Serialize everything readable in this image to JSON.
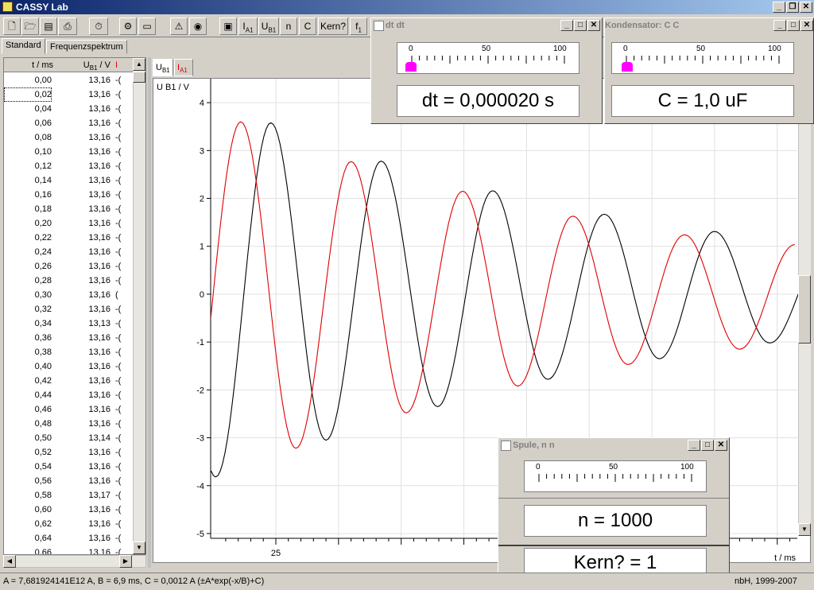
{
  "window": {
    "title": "CASSY Lab"
  },
  "toolbar": {
    "btn_n": "n",
    "btn_c": "C",
    "btn_kern": "Kern?",
    "btn_f1": "f"
  },
  "tabs": [
    "Standard",
    "Frequenzspektrum"
  ],
  "table": {
    "headers": [
      "t / ms",
      "U",
      "I"
    ],
    "header_unit": "/ V",
    "rows": [
      [
        "0,00",
        "13,16",
        "-("
      ],
      [
        "0,02",
        "13,16",
        "-("
      ],
      [
        "0,04",
        "13,16",
        "-("
      ],
      [
        "0,06",
        "13,16",
        "-("
      ],
      [
        "0,08",
        "13,16",
        "-("
      ],
      [
        "0,10",
        "13,16",
        "-("
      ],
      [
        "0,12",
        "13,16",
        "-("
      ],
      [
        "0,14",
        "13,16",
        "-("
      ],
      [
        "0,16",
        "13,16",
        "-("
      ],
      [
        "0,18",
        "13,16",
        "-("
      ],
      [
        "0,20",
        "13,16",
        "-("
      ],
      [
        "0,22",
        "13,16",
        "-("
      ],
      [
        "0,24",
        "13,16",
        "-("
      ],
      [
        "0,26",
        "13,16",
        "-("
      ],
      [
        "0,28",
        "13,16",
        "-("
      ],
      [
        "0,30",
        "13,16",
        "("
      ],
      [
        "0,32",
        "13,16",
        "-("
      ],
      [
        "0,34",
        "13,13",
        "-("
      ],
      [
        "0,36",
        "13,16",
        "-("
      ],
      [
        "0,38",
        "13,16",
        "-("
      ],
      [
        "0,40",
        "13,16",
        "-("
      ],
      [
        "0,42",
        "13,16",
        "-("
      ],
      [
        "0,44",
        "13,16",
        "-("
      ],
      [
        "0,46",
        "13,16",
        "-("
      ],
      [
        "0,48",
        "13,16",
        "-("
      ],
      [
        "0,50",
        "13,14",
        "-("
      ],
      [
        "0,52",
        "13,16",
        "-("
      ],
      [
        "0,54",
        "13,16",
        "-("
      ],
      [
        "0,56",
        "13,16",
        "-("
      ],
      [
        "0,58",
        "13,17",
        "-("
      ],
      [
        "0,60",
        "13,16",
        "-("
      ],
      [
        "0,62",
        "13,16",
        "-("
      ],
      [
        "0,64",
        "13,16",
        "-("
      ],
      [
        "0,66",
        "13,16",
        "-("
      ]
    ],
    "selected_row": 1
  },
  "plot_tabs": [
    "U",
    "I"
  ],
  "chart_data": {
    "type": "line",
    "ylabel": "U B1 / V",
    "xlabel": "t / ms",
    "ylim": [
      -5.1,
      4.5
    ],
    "y_ticks": [
      "4",
      "3",
      "2",
      "1",
      "0",
      "-1",
      "-2",
      "-3",
      "-4",
      "-5"
    ],
    "x_ticks": [
      "25"
    ],
    "grid": true,
    "series": [
      {
        "name": "U",
        "color": "#000000",
        "peaks": [
          [
            24.6,
            3.58
          ],
          [
            33.4,
            2.78
          ],
          [
            42.3,
            2.16
          ],
          [
            51.2,
            1.67
          ],
          [
            60.0,
            1.31
          ]
        ],
        "troughs": [
          [
            20.2,
            -3.82
          ],
          [
            29.0,
            -3.05
          ],
          [
            37.9,
            -2.35
          ],
          [
            46.7,
            -1.78
          ],
          [
            55.6,
            -1.35
          ],
          [
            64.4,
            -1.02
          ]
        ]
      },
      {
        "name": "I",
        "color": "#e00000",
        "peaks": [
          [
            22.2,
            3.6
          ],
          [
            31.0,
            2.77
          ],
          [
            39.9,
            2.15
          ],
          [
            48.7,
            1.63
          ],
          [
            57.6,
            1.24
          ]
        ],
        "troughs": [
          [
            26.6,
            -3.22
          ],
          [
            35.4,
            -2.48
          ],
          [
            44.3,
            -1.92
          ],
          [
            53.1,
            -1.47
          ],
          [
            62.0,
            -1.15
          ]
        ]
      }
    ]
  },
  "panel_dt": {
    "title": "dt dt",
    "scale": [
      "0",
      "50",
      "100"
    ],
    "value_text": "dt =  0,000020 s"
  },
  "panel_c": {
    "title": "Kondensator: C  C",
    "scale": [
      "0",
      "50",
      "100"
    ],
    "value_text": "C =  1,0 uF"
  },
  "panel_spule": {
    "title": "Spule, n  n",
    "scale": [
      "0",
      "50",
      "100"
    ],
    "value_n": "n =  1000",
    "value_kern": "Kern? =  1"
  },
  "statusbar": {
    "fit_text": "A = 7,681924141E12 A,   B = 6,9 ms,   C = 0,0012 A   (±A*exp(-x/B)+C)",
    "copyright": "nbH, 1999-2007"
  },
  "colors": {
    "accent": "#0a246a",
    "red_series": "#e00000",
    "slider_marker": "#ff00ff"
  }
}
